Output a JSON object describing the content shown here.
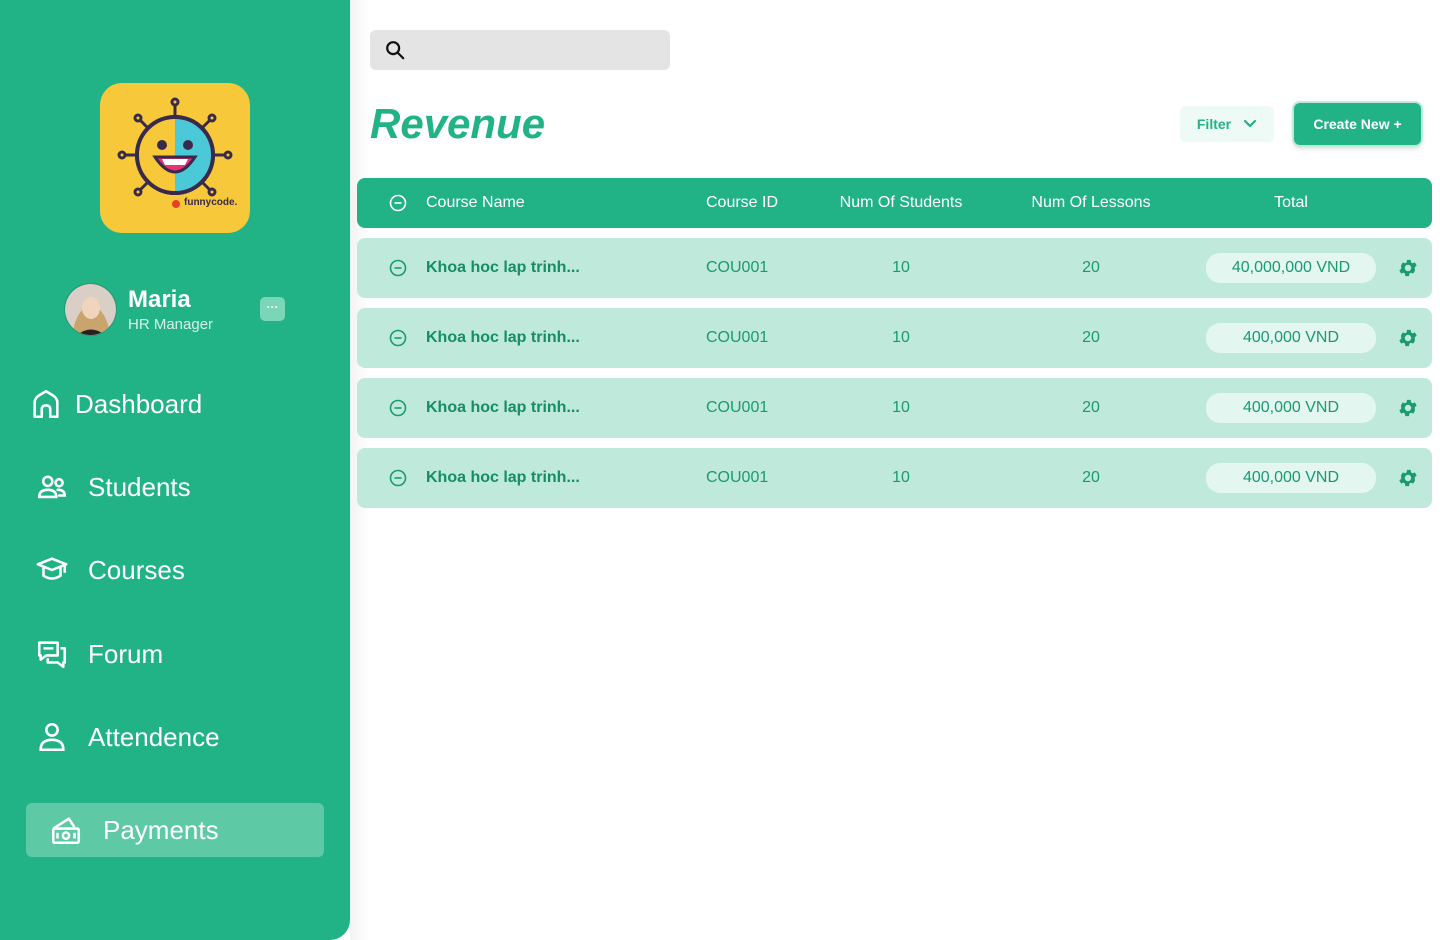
{
  "sidebar": {
    "logo_text": "funnycode.",
    "profile": {
      "name": "Maria",
      "role": "HR Manager",
      "more_label": "···"
    },
    "nav": [
      {
        "label": "Dashboard",
        "icon": "home-icon"
      },
      {
        "label": "Students",
        "icon": "users-icon"
      },
      {
        "label": "Courses",
        "icon": "graduation-cap-icon"
      },
      {
        "label": "Forum",
        "icon": "chat-icon"
      },
      {
        "label": "Attendence",
        "icon": "person-icon"
      },
      {
        "label": "Payments",
        "icon": "money-icon",
        "active": true
      }
    ]
  },
  "search": {
    "placeholder": ""
  },
  "header": {
    "title": "Revenue",
    "filter_label": "Filter",
    "create_label": "Create New +"
  },
  "table": {
    "columns": [
      "Course Name",
      "Course ID",
      "Num Of Students",
      "Num Of Lessons",
      "Total"
    ],
    "rows": [
      {
        "name": "Khoa hoc lap trinh...",
        "id": "COU001",
        "students": "10",
        "lessons": "20",
        "total": "40,000,000 VND"
      },
      {
        "name": "Khoa hoc lap trinh...",
        "id": "COU001",
        "students": "10",
        "lessons": "20",
        "total": "400,000 VND"
      },
      {
        "name": "Khoa hoc lap trinh...",
        "id": "COU001",
        "students": "10",
        "lessons": "20",
        "total": "400,000 VND"
      },
      {
        "name": "Khoa hoc lap trinh...",
        "id": "COU001",
        "students": "10",
        "lessons": "20",
        "total": "400,000 VND"
      }
    ]
  },
  "colors": {
    "primary": "#21b386",
    "row_bg": "#bfe9da",
    "active_nav": "#5ec9a5",
    "logo_bg": "#f7c93a"
  }
}
